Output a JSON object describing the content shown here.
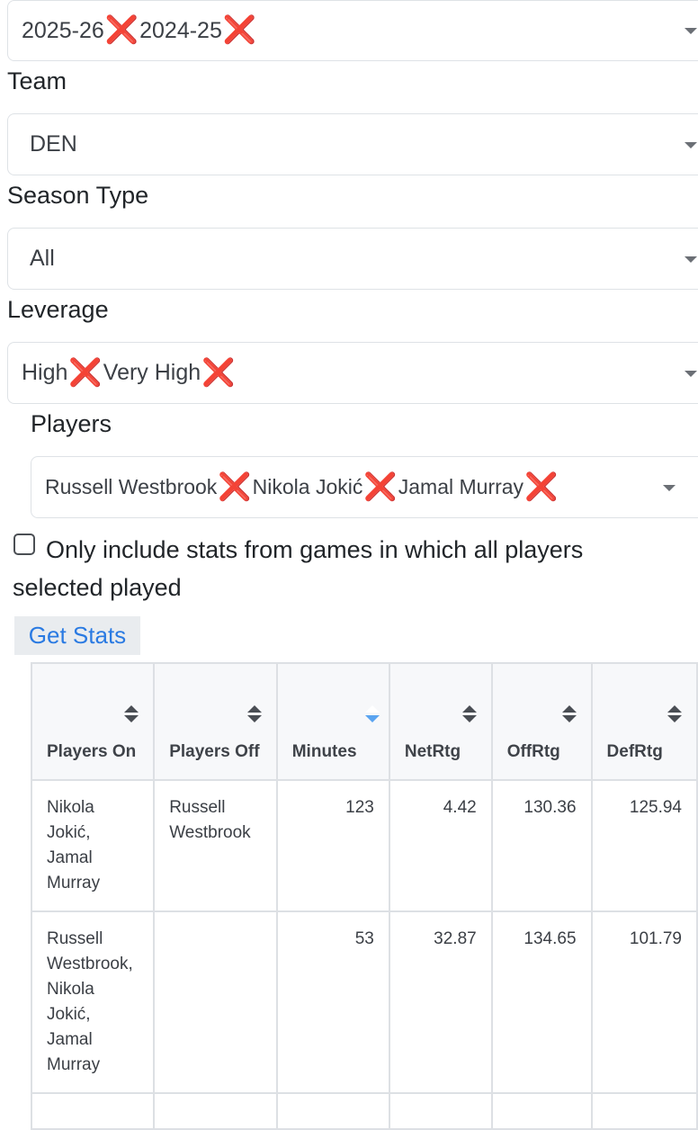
{
  "filters": {
    "season": {
      "chips": [
        "2025-26",
        "2024-25"
      ]
    },
    "team": {
      "label": "Team",
      "value": "DEN"
    },
    "season_type": {
      "label": "Season Type",
      "value": "All"
    },
    "leverage": {
      "label": "Leverage",
      "chips": [
        "High",
        "Very High"
      ]
    },
    "players": {
      "label": "Players",
      "chips": [
        "Russell Westbrook",
        "Nikola Jokić",
        "Jamal Murray"
      ]
    },
    "remove_glyph": "❌"
  },
  "checkbox": {
    "label": "Only include stats from games in which all players selected played",
    "checked": false
  },
  "button": {
    "label": "Get Stats"
  },
  "table": {
    "headers": {
      "players_on": "Players On",
      "players_off": "Players Off",
      "minutes": "Minutes",
      "netrtg": "NetRtg",
      "offrtg": "OffRtg",
      "defrtg": "DefRtg"
    },
    "rows": [
      {
        "players_on": "Nikola Jokić, Jamal Murray",
        "players_off": "Russell Westbrook",
        "minutes": "123",
        "netrtg": "4.42",
        "offrtg": "130.36",
        "defrtg": "125.94"
      },
      {
        "players_on": "Russell Westbrook, Nikola Jokić, Jamal Murray",
        "players_off": "",
        "minutes": "53",
        "netrtg": "32.87",
        "offrtg": "134.65",
        "defrtg": "101.79"
      }
    ]
  },
  "colors": {
    "accent": "#2a7ae2",
    "remove": "#d9301c",
    "sort_active": "#5aa4f0"
  }
}
